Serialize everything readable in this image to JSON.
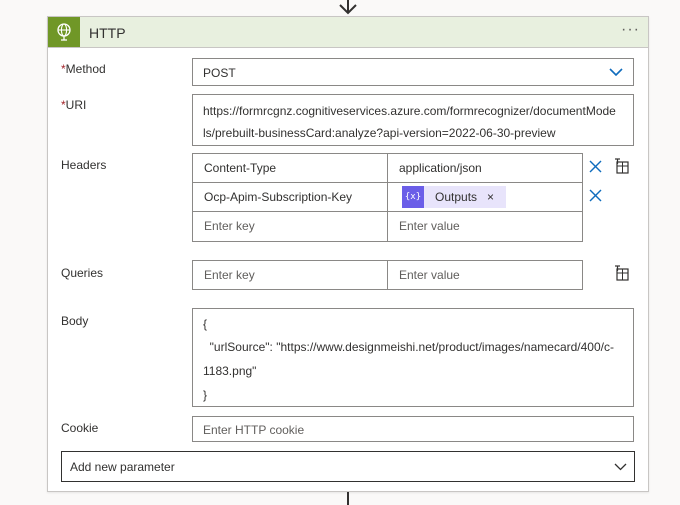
{
  "card": {
    "title": "HTTP",
    "more_label": "···",
    "icon": "globe-icon"
  },
  "method": {
    "required_mark": "*",
    "label": "Method",
    "value": "POST"
  },
  "uri": {
    "required_mark": "*",
    "label": "URI",
    "line1": "https://formrcgnz.cognitiveservices.azure.com/formrecognizer/documentMode",
    "line2": "ls/prebuilt-businessCard:analyze?api-version=2022-06-30-preview"
  },
  "headers": {
    "label": "Headers",
    "rows": [
      {
        "key": "Content-Type",
        "value": "application/json"
      },
      {
        "key": "Ocp-Apim-Subscription-Key",
        "token_label": "Outputs",
        "token_close": "×",
        "token_icon_text": "{x}"
      }
    ],
    "key_placeholder": "Enter key",
    "value_placeholder": "Enter value"
  },
  "queries": {
    "label": "Queries",
    "key_placeholder": "Enter key",
    "value_placeholder": "Enter value"
  },
  "body": {
    "label": "Body",
    "lines": [
      "{",
      "  \"urlSource\": \"https://www.designmeishi.net/product/images/namecard/400/c-",
      "1183.png\"",
      "}"
    ]
  },
  "cookie": {
    "label": "Cookie",
    "placeholder": "Enter HTTP cookie"
  },
  "add_parameter": {
    "label": "Add new parameter"
  },
  "colors": {
    "header_bg": "#e8f0df",
    "icon_bg": "#709727",
    "accent_blue": "#0f6cbd",
    "token_bg": "#e8e4fb",
    "token_icon_bg": "#6b5ee8",
    "required": "#a4262c"
  }
}
